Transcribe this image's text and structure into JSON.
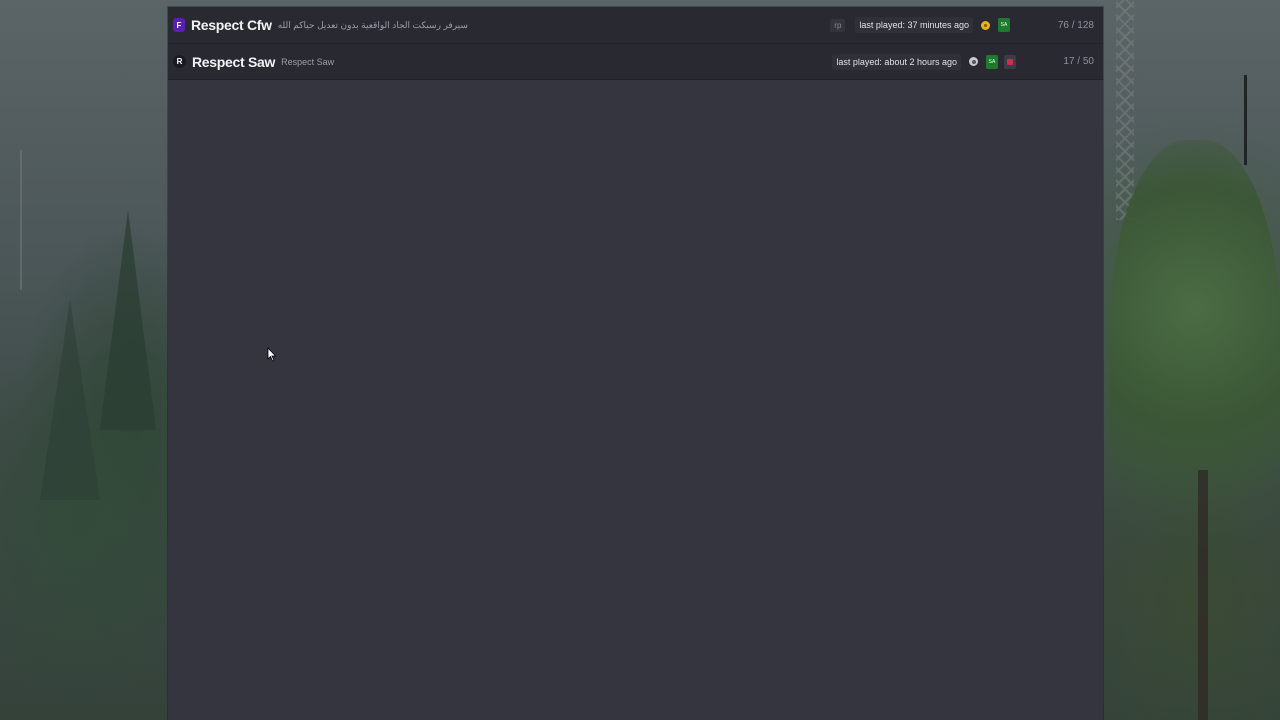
{
  "servers": [
    {
      "icon_letter": "F",
      "name": "Respect Cfw",
      "description": "سيرفر رسبكت الجاد الواقعية بدون تعديل حياكم الله",
      "tag": "rp",
      "last_played": "last played: 37 minutes ago",
      "badge_icon": "gold-coin-icon",
      "flag_icon": "saudi-flag-icon",
      "flag_text": "SA",
      "players": "76 / 128"
    },
    {
      "icon_letter": "R",
      "name": "Respect Saw",
      "description": "Respect Saw",
      "last_played": "last played: about 2 hours ago",
      "badge_icon": "silver-coin-icon",
      "flag_icon": "saudi-flag-icon",
      "flag_text": "SA",
      "extra_icon": "heart-icon",
      "players": "17 / 50"
    }
  ],
  "colors": {
    "panel_bg": "#34353e",
    "row_bg": "#292a31",
    "accent_purple": "#5a1fb1",
    "gold": "#e8b21c",
    "flag_green": "#1d7a2f"
  }
}
